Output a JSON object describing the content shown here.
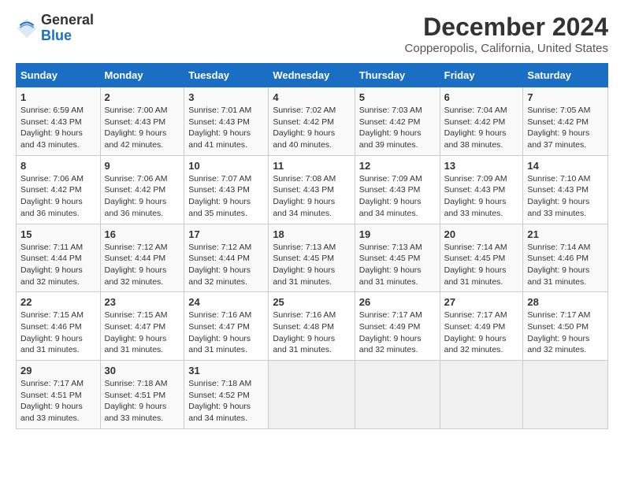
{
  "header": {
    "logo_general": "General",
    "logo_blue": "Blue",
    "main_title": "December 2024",
    "subtitle": "Copperopolis, California, United States"
  },
  "columns": [
    "Sunday",
    "Monday",
    "Tuesday",
    "Wednesday",
    "Thursday",
    "Friday",
    "Saturday"
  ],
  "weeks": [
    [
      {
        "day": "1",
        "sunrise": "6:59 AM",
        "sunset": "4:43 PM",
        "daylight": "9 hours and 43 minutes."
      },
      {
        "day": "2",
        "sunrise": "7:00 AM",
        "sunset": "4:43 PM",
        "daylight": "9 hours and 42 minutes."
      },
      {
        "day": "3",
        "sunrise": "7:01 AM",
        "sunset": "4:43 PM",
        "daylight": "9 hours and 41 minutes."
      },
      {
        "day": "4",
        "sunrise": "7:02 AM",
        "sunset": "4:42 PM",
        "daylight": "9 hours and 40 minutes."
      },
      {
        "day": "5",
        "sunrise": "7:03 AM",
        "sunset": "4:42 PM",
        "daylight": "9 hours and 39 minutes."
      },
      {
        "day": "6",
        "sunrise": "7:04 AM",
        "sunset": "4:42 PM",
        "daylight": "9 hours and 38 minutes."
      },
      {
        "day": "7",
        "sunrise": "7:05 AM",
        "sunset": "4:42 PM",
        "daylight": "9 hours and 37 minutes."
      }
    ],
    [
      {
        "day": "8",
        "sunrise": "7:06 AM",
        "sunset": "4:42 PM",
        "daylight": "9 hours and 36 minutes."
      },
      {
        "day": "9",
        "sunrise": "7:06 AM",
        "sunset": "4:42 PM",
        "daylight": "9 hours and 36 minutes."
      },
      {
        "day": "10",
        "sunrise": "7:07 AM",
        "sunset": "4:43 PM",
        "daylight": "9 hours and 35 minutes."
      },
      {
        "day": "11",
        "sunrise": "7:08 AM",
        "sunset": "4:43 PM",
        "daylight": "9 hours and 34 minutes."
      },
      {
        "day": "12",
        "sunrise": "7:09 AM",
        "sunset": "4:43 PM",
        "daylight": "9 hours and 34 minutes."
      },
      {
        "day": "13",
        "sunrise": "7:09 AM",
        "sunset": "4:43 PM",
        "daylight": "9 hours and 33 minutes."
      },
      {
        "day": "14",
        "sunrise": "7:10 AM",
        "sunset": "4:43 PM",
        "daylight": "9 hours and 33 minutes."
      }
    ],
    [
      {
        "day": "15",
        "sunrise": "7:11 AM",
        "sunset": "4:44 PM",
        "daylight": "9 hours and 32 minutes."
      },
      {
        "day": "16",
        "sunrise": "7:12 AM",
        "sunset": "4:44 PM",
        "daylight": "9 hours and 32 minutes."
      },
      {
        "day": "17",
        "sunrise": "7:12 AM",
        "sunset": "4:44 PM",
        "daylight": "9 hours and 32 minutes."
      },
      {
        "day": "18",
        "sunrise": "7:13 AM",
        "sunset": "4:45 PM",
        "daylight": "9 hours and 31 minutes."
      },
      {
        "day": "19",
        "sunrise": "7:13 AM",
        "sunset": "4:45 PM",
        "daylight": "9 hours and 31 minutes."
      },
      {
        "day": "20",
        "sunrise": "7:14 AM",
        "sunset": "4:45 PM",
        "daylight": "9 hours and 31 minutes."
      },
      {
        "day": "21",
        "sunrise": "7:14 AM",
        "sunset": "4:46 PM",
        "daylight": "9 hours and 31 minutes."
      }
    ],
    [
      {
        "day": "22",
        "sunrise": "7:15 AM",
        "sunset": "4:46 PM",
        "daylight": "9 hours and 31 minutes."
      },
      {
        "day": "23",
        "sunrise": "7:15 AM",
        "sunset": "4:47 PM",
        "daylight": "9 hours and 31 minutes."
      },
      {
        "day": "24",
        "sunrise": "7:16 AM",
        "sunset": "4:47 PM",
        "daylight": "9 hours and 31 minutes."
      },
      {
        "day": "25",
        "sunrise": "7:16 AM",
        "sunset": "4:48 PM",
        "daylight": "9 hours and 31 minutes."
      },
      {
        "day": "26",
        "sunrise": "7:17 AM",
        "sunset": "4:49 PM",
        "daylight": "9 hours and 32 minutes."
      },
      {
        "day": "27",
        "sunrise": "7:17 AM",
        "sunset": "4:49 PM",
        "daylight": "9 hours and 32 minutes."
      },
      {
        "day": "28",
        "sunrise": "7:17 AM",
        "sunset": "4:50 PM",
        "daylight": "9 hours and 32 minutes."
      }
    ],
    [
      {
        "day": "29",
        "sunrise": "7:17 AM",
        "sunset": "4:51 PM",
        "daylight": "9 hours and 33 minutes."
      },
      {
        "day": "30",
        "sunrise": "7:18 AM",
        "sunset": "4:51 PM",
        "daylight": "9 hours and 33 minutes."
      },
      {
        "day": "31",
        "sunrise": "7:18 AM",
        "sunset": "4:52 PM",
        "daylight": "9 hours and 34 minutes."
      },
      null,
      null,
      null,
      null
    ]
  ]
}
